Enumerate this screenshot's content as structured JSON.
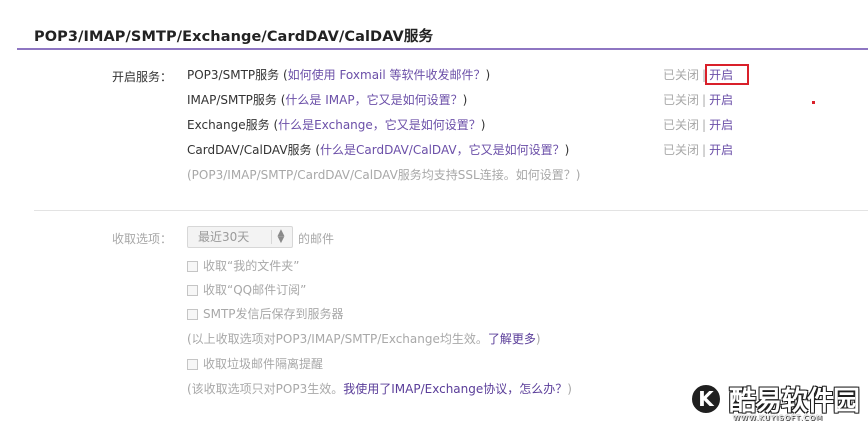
{
  "section": {
    "title": "POP3/IMAP/SMTP/Exchange/CardDAV/CalDAV服务"
  },
  "services": {
    "label": "开启服务：",
    "items": [
      {
        "name": "POP3/SMTP服务",
        "open_paren": " (",
        "help": "如何使用 Foxmail 等软件收发邮件？",
        "close_paren": ")",
        "status_off": "已关闭",
        "status_sep": "|",
        "status_on": "开启"
      },
      {
        "name": "IMAP/SMTP服务",
        "open_paren": " (",
        "help": "什么是 IMAP，它又是如何设置？",
        "close_paren": ")",
        "status_off": "已关闭",
        "status_sep": "|",
        "status_on": "开启"
      },
      {
        "name": "Exchange服务",
        "open_paren": " (",
        "help": "什么是Exchange，它又是如何设置？",
        "close_paren": ")",
        "status_off": "已关闭",
        "status_sep": "|",
        "status_on": "开启"
      },
      {
        "name": "CardDAV/CalDAV服务",
        "open_paren": " (",
        "help": "什么是CardDAV/CalDAV，它又是如何设置？",
        "close_paren": ")",
        "status_off": "已关闭",
        "status_sep": "|",
        "status_on": "开启"
      }
    ],
    "ssl_note_prefix": "(POP3/IMAP/SMTP/CardDAV/CalDAV服务均支持SSL连接。",
    "ssl_note_link": "如何设置？",
    "ssl_note_suffix": ")"
  },
  "receive": {
    "label": "收取选项：",
    "select_value": "最近30天",
    "select_suffix": "的邮件",
    "options": [
      {
        "label": "收取“我的文件夹”"
      },
      {
        "label": "收取“QQ邮件订阅”"
      },
      {
        "label": "SMTP发信后保存到服务器"
      }
    ],
    "note1_prefix": "(以上收取选项对POP3/IMAP/SMTP/Exchange均生效。",
    "note1_link": "了解更多",
    "note1_suffix": ")",
    "spam_option": "收取垃圾邮件隔离提醒",
    "note2_prefix": "(该收取选项只对POP3生效。",
    "note2_link": "我使用了IMAP/Exchange协议，怎么办？",
    "note2_suffix": ")"
  },
  "watermark": {
    "logo_letter": "K",
    "text": "酷易软件园",
    "sub": "WWW.KUYISOFT.COM"
  },
  "colors": {
    "accent_rule": "#8e76c2",
    "link_purple": "#6b4fa8",
    "highlight_red": "#d9202a"
  }
}
